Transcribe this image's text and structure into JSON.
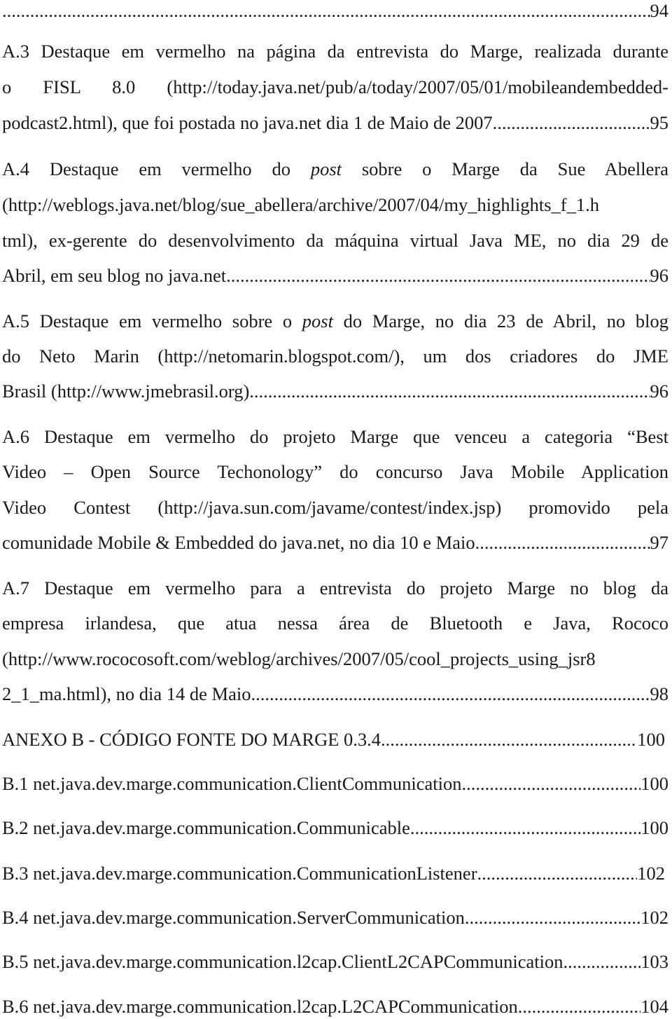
{
  "page": {
    "top_entry_page": "94",
    "entries": [
      {
        "id": "A.3",
        "lines": [
          "A.3  Destaque em vermelho na página da entrevista do Marge, realizada durante",
          "o  FISL  8.0  (http://today.java.net/pub/a/today/2007/05/01/mobileandembedded-"
        ],
        "last_line": "podcast2.html), que foi postada no java.net dia 1 de Maio de 2007",
        "page": "95"
      },
      {
        "id": "A.4",
        "first_pre": "A.4 Destaque em vermelho do ",
        "first_italic": "post",
        "first_post": " sobre o Marge da Sue Abellera",
        "lines": [
          "(http://weblogs.java.net/blog/sue_abellera/archive/2007/04/my_highlights_f_1.h",
          "tml), ex-gerente do desenvolvimento da máquina virtual Java ME, no dia 29 de"
        ],
        "last_line": "Abril, em seu blog no java.net",
        "page": "96"
      },
      {
        "id": "A.5",
        "first_pre": "A.5 Destaque em vermelho sobre o ",
        "first_italic": "post",
        "first_post": " do Marge, no dia 23 de Abril, no blog",
        "lines": [
          "do Neto Marin (http://netomarin.blogspot.com/), um dos criadores do JME"
        ],
        "last_line": "Brasil (http://www.jmebrasil.org)",
        "page": "96"
      },
      {
        "id": "A.6",
        "lines": [
          "A.6 Destaque em vermelho do projeto Marge que venceu a categoria “Best",
          "Video – Open Source Techonology” do concurso Java Mobile Application",
          "Video Contest (http://java.sun.com/javame/contest/index.jsp) promovido pela"
        ],
        "last_line": "comunidade Mobile & Embedded do java.net, no dia 10 e Maio. ",
        "page": "97"
      },
      {
        "id": "A.7",
        "lines": [
          "A.7 Destaque em vermelho para a entrevista do projeto Marge no blog da",
          "empresa irlandesa, que atua nessa área de Bluetooth e Java, Rococo",
          "(http://www.rococosoft.com/weblog/archives/2007/05/cool_projects_using_jsr8"
        ],
        "last_line": "2_1_ma.html), no dia 14 de Maio.. ",
        "page": "98"
      }
    ],
    "annex": {
      "title": "ANEXO B - CÓDIGO FONTE DO MARGE 0.3.4",
      "page": "100"
    },
    "annex_items": [
      {
        "label": "B.1 net.java.dev.marge.communication.ClientCommunication",
        "page": "100"
      },
      {
        "label": "B.2 net.java.dev.marge.communication.Communicable",
        "page": "100"
      },
      {
        "label": "B.3 net.java.dev.marge.communication.CommunicationListener",
        "page": "102"
      },
      {
        "label": "B.4 net.java.dev.marge.communication.ServerCommunication",
        "page": "102"
      },
      {
        "label": "B.5 net.java.dev.marge.communication.l2cap.ClientL2CAPCommunication",
        "page": "103"
      },
      {
        "label": "B.6 net.java.dev.marge.communication.l2cap.L2CAPCommunication",
        "page": "104"
      }
    ]
  }
}
